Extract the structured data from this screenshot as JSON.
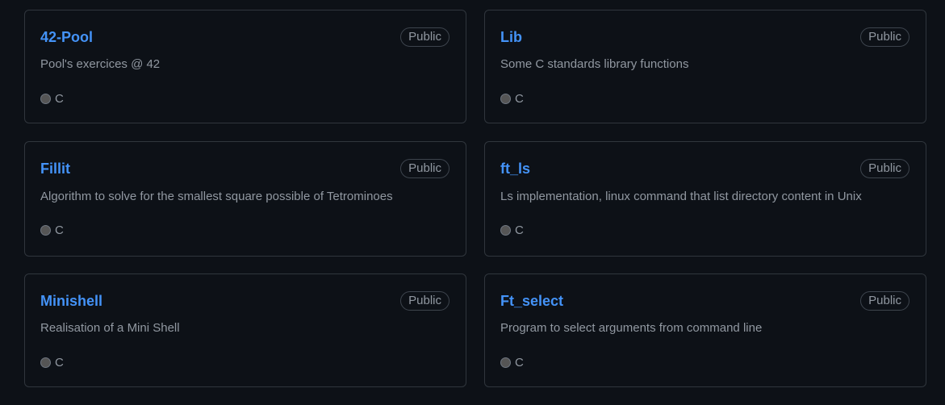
{
  "repos": [
    {
      "name": "42-Pool",
      "visibility": "Public",
      "description": "Pool's exercices @ 42",
      "language": "C",
      "language_color": "#555555"
    },
    {
      "name": "Lib",
      "visibility": "Public",
      "description": "Some C standards library functions",
      "language": "C",
      "language_color": "#555555"
    },
    {
      "name": "Fillit",
      "visibility": "Public",
      "description": "Algorithm to solve for the smallest square possible of Tetrominoes",
      "language": "C",
      "language_color": "#555555"
    },
    {
      "name": "ft_ls",
      "visibility": "Public",
      "description": "Ls implementation, linux command that list directory content in Unix",
      "language": "C",
      "language_color": "#555555"
    },
    {
      "name": "Minishell",
      "visibility": "Public",
      "description": "Realisation of a Mini Shell",
      "language": "C",
      "language_color": "#555555"
    },
    {
      "name": "Ft_select",
      "visibility": "Public",
      "description": "Program to select arguments from command line",
      "language": "C",
      "language_color": "#555555"
    }
  ],
  "colors": {
    "background": "#0d1117",
    "border": "#30363d",
    "link": "#4493f8",
    "muted_text": "#9198a1"
  }
}
